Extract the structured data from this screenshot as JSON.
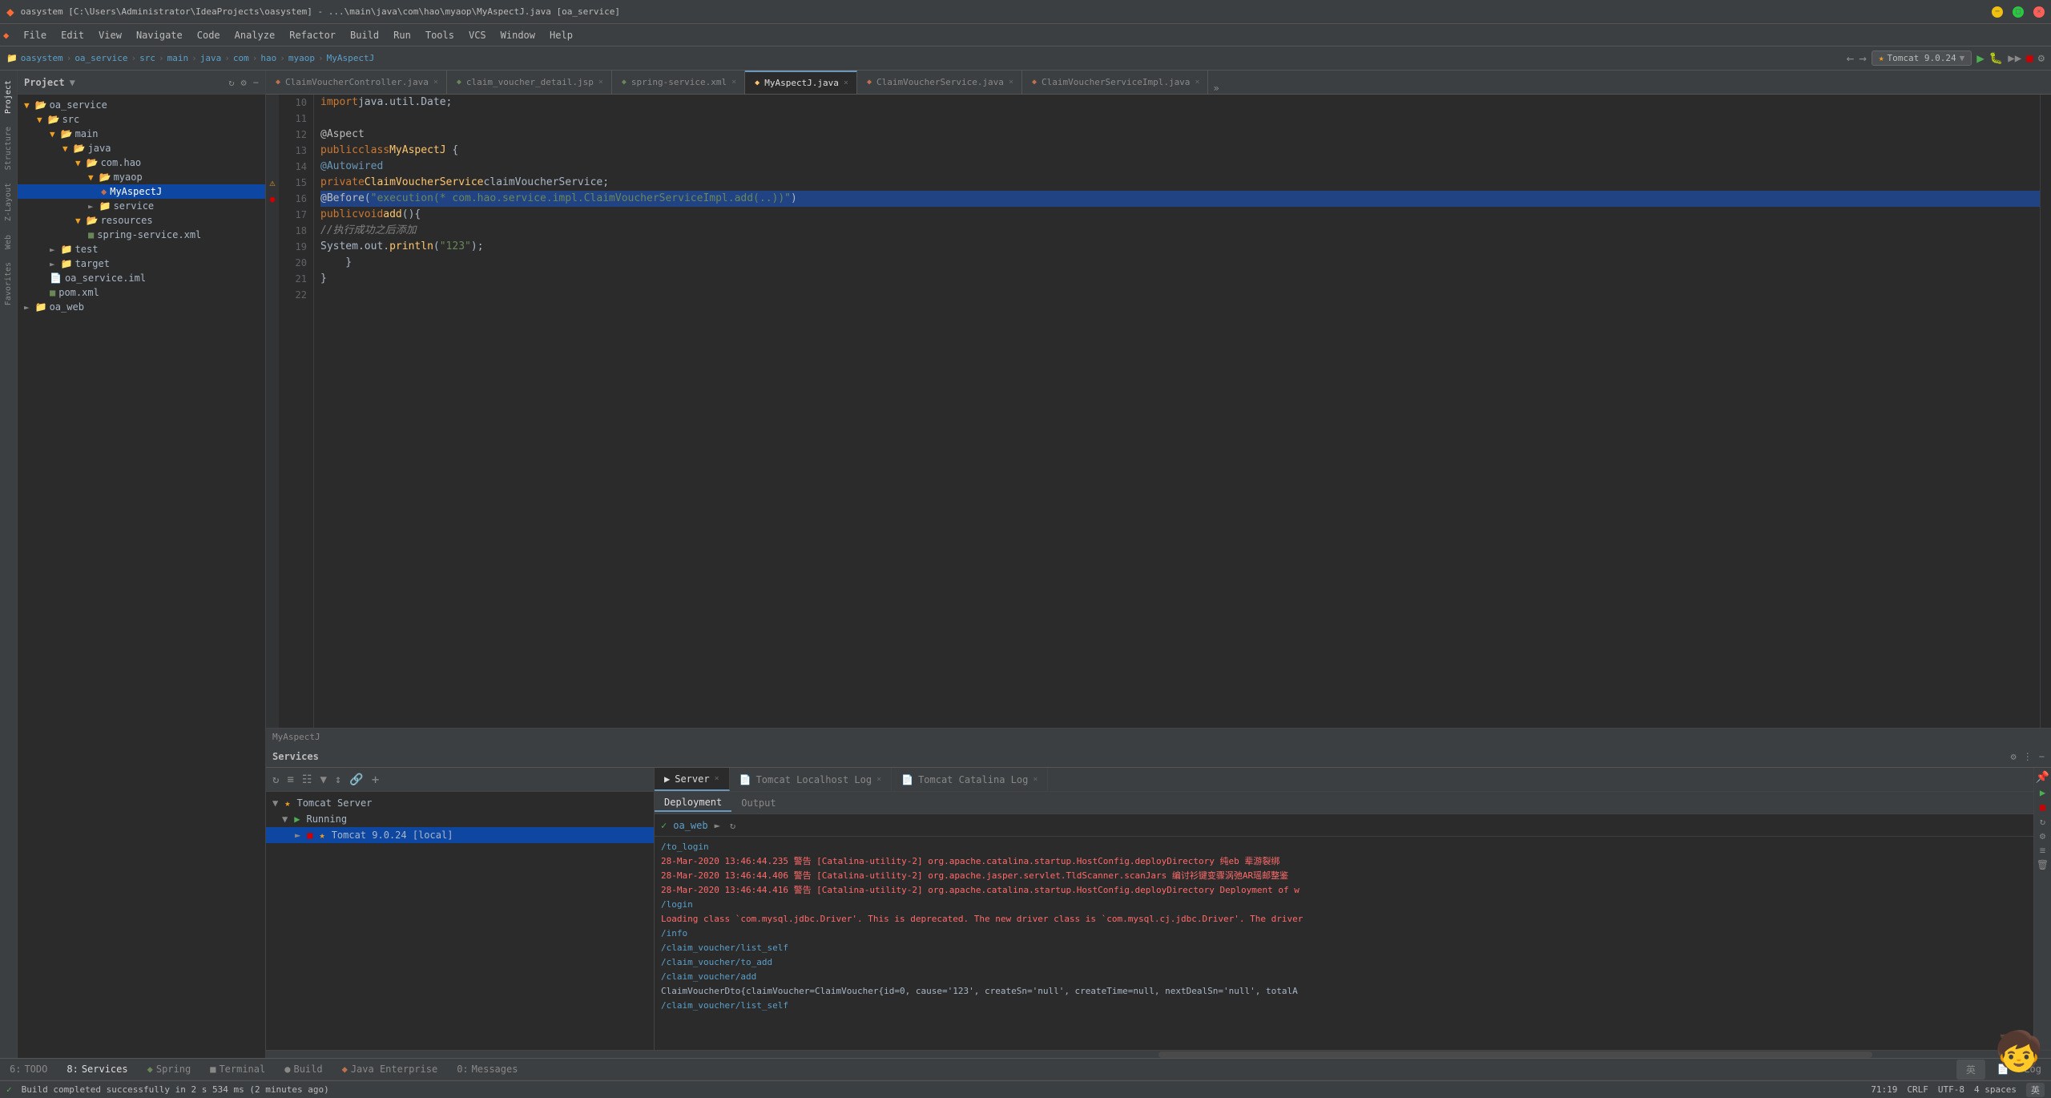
{
  "titlebar": {
    "app_icon": "idea-icon",
    "title": "oasystem [C:\\Users\\Administrator\\IdeaProjects\\oasystem] - ...\\main\\java\\com\\hao\\myaop\\MyAspectJ.java [oa_service]",
    "min_label": "−",
    "max_label": "□",
    "close_label": "×",
    "menus": [
      "File",
      "Edit",
      "View",
      "Navigate",
      "Code",
      "Analyze",
      "Refactor",
      "Build",
      "Run",
      "Tools",
      "VCS",
      "Window",
      "Help"
    ]
  },
  "breadcrumb": {
    "items": [
      "oasystem",
      "oa_service",
      "src",
      "main",
      "java",
      "com",
      "hao",
      "myaop",
      "MyAspectJ"
    ]
  },
  "tabs": [
    {
      "label": "ClaimVoucherController.java",
      "active": false
    },
    {
      "label": "claim_voucher_detail.jsp",
      "active": false
    },
    {
      "label": "spring-service.xml",
      "active": false
    },
    {
      "label": "MyAspectJ.java",
      "active": true
    },
    {
      "label": "ClaimVoucherService.java",
      "active": false
    },
    {
      "label": "ClaimVoucherServiceImpl.java",
      "active": false
    }
  ],
  "toolbar_right": {
    "tomcat_label": "Tomcat 9.0.24"
  },
  "project_tree": {
    "title": "Project",
    "items": [
      {
        "indent": 0,
        "type": "folder",
        "label": "oa_service",
        "expanded": true
      },
      {
        "indent": 1,
        "type": "folder",
        "label": "src",
        "expanded": true
      },
      {
        "indent": 2,
        "type": "folder",
        "label": "main",
        "expanded": true
      },
      {
        "indent": 3,
        "type": "folder",
        "label": "java",
        "expanded": true
      },
      {
        "indent": 4,
        "type": "folder",
        "label": "com.hao",
        "expanded": true
      },
      {
        "indent": 5,
        "type": "folder",
        "label": "myaop",
        "expanded": true
      },
      {
        "indent": 6,
        "type": "java",
        "label": "MyAspectJ",
        "selected": true
      },
      {
        "indent": 5,
        "type": "folder",
        "label": "service",
        "expanded": false
      },
      {
        "indent": 2,
        "type": "folder",
        "label": "resources",
        "expanded": true
      },
      {
        "indent": 3,
        "type": "xml",
        "label": "spring-service.xml"
      },
      {
        "indent": 1,
        "type": "folder",
        "label": "test",
        "expanded": false
      },
      {
        "indent": 1,
        "type": "folder",
        "label": "target",
        "expanded": false
      },
      {
        "indent": 1,
        "type": "file",
        "label": "oa_service.iml"
      },
      {
        "indent": 1,
        "type": "file",
        "label": "pom.xml"
      },
      {
        "indent": 0,
        "type": "folder",
        "label": "oa_web",
        "expanded": false
      }
    ]
  },
  "code": {
    "lines": [
      {
        "num": 10,
        "text": "import java.util.Date;",
        "type": "normal"
      },
      {
        "num": 11,
        "text": "",
        "type": "normal"
      },
      {
        "num": 12,
        "text": "@Aspect",
        "type": "annotation"
      },
      {
        "num": 13,
        "text": "public class MyAspectJ {",
        "type": "normal"
      },
      {
        "num": 14,
        "text": "    @Autowired",
        "type": "annotation"
      },
      {
        "num": 15,
        "text": "    private ClaimVoucherService claimVoucherService;",
        "type": "normal"
      },
      {
        "num": 16,
        "text": "    @Before(\"execution(* com.hao.service.impl.ClaimVoucherServiceImpl.add(..))\")",
        "type": "highlighted"
      },
      {
        "num": 17,
        "text": "    public void add(){",
        "type": "normal"
      },
      {
        "num": 18,
        "text": "        //执行成功之后添加",
        "type": "comment"
      },
      {
        "num": 19,
        "text": "        System.out.println(\"123\");",
        "type": "normal"
      },
      {
        "num": 20,
        "text": "    }",
        "type": "normal"
      },
      {
        "num": 21,
        "text": "}",
        "type": "normal"
      },
      {
        "num": 22,
        "text": "",
        "type": "normal"
      }
    ],
    "breadcrumb_bottom": "MyAspectJ"
  },
  "services_panel": {
    "title": "Services",
    "tree": {
      "tomcat_server": "Tomcat Server",
      "running_label": "Running",
      "tomcat_version": "Tomcat 9.0.24 [local]"
    },
    "deployment": {
      "tab": "Deployment",
      "output_tab": "Output",
      "oa_web": "oa_web"
    },
    "log_tabs": [
      {
        "label": "Server",
        "active": true
      },
      {
        "label": "Tomcat Localhost Log",
        "active": false
      },
      {
        "label": "Tomcat Catalina Log",
        "active": false
      }
    ],
    "log_subtabs": [
      {
        "label": "Deployment",
        "active": true
      },
      {
        "label": "Output",
        "active": false
      }
    ],
    "log_lines": [
      "/to_login",
      "28-Mar-2020 13:46:44.235 警告 [Catalina-utility-2] org.apache.catalina.startup.HostConfig.deployDirectory 纯eb 辈游裂绑",
      "28-Mar-2020 13:46:44.406 警告 [Catalina-utility-2] org.apache.jasper.servlet.TldScanner.scanJars 编讨衫键变骤涡弛AR瑶邮整鉴",
      "28-Mar-2020 13:46:44.416 警告 [Catalina-utility-2] org.apache.catalina.startup.HostConfig.deployDirectory Deployment of w",
      "/login",
      "Loading class `com.mysql.jdbc.Driver'. This is deprecated. The new driver class is `com.mysql.cj.jdbc.Driver'. The driver",
      "/info",
      "/claim_voucher/list_self",
      "/claim_voucher/to_add",
      "/claim_voucher/add",
      "ClaimVoucherDto{claimVoucher=ClaimVoucher{id=0, cause='123', createSn='null', createTime=null, nextDealSn='null', totalA",
      "/claim_voucher/list_self"
    ]
  },
  "bottom_tabs": [
    {
      "num": "6",
      "label": "TODO"
    },
    {
      "num": "8",
      "label": "Services",
      "active": true
    },
    {
      "label": "Spring"
    },
    {
      "label": "Terminal"
    },
    {
      "label": "Build"
    },
    {
      "label": "Java Enterprise"
    },
    {
      "num": "0",
      "label": "Messages"
    }
  ],
  "status_bar": {
    "left": "Build completed successfully in 2 s 534 ms (2 minutes ago)",
    "right_position": "71:19",
    "right_crlf": "CRLF",
    "right_encoding": "UTF-8",
    "right_spaces": "4 spaces",
    "right_lang": "英"
  }
}
